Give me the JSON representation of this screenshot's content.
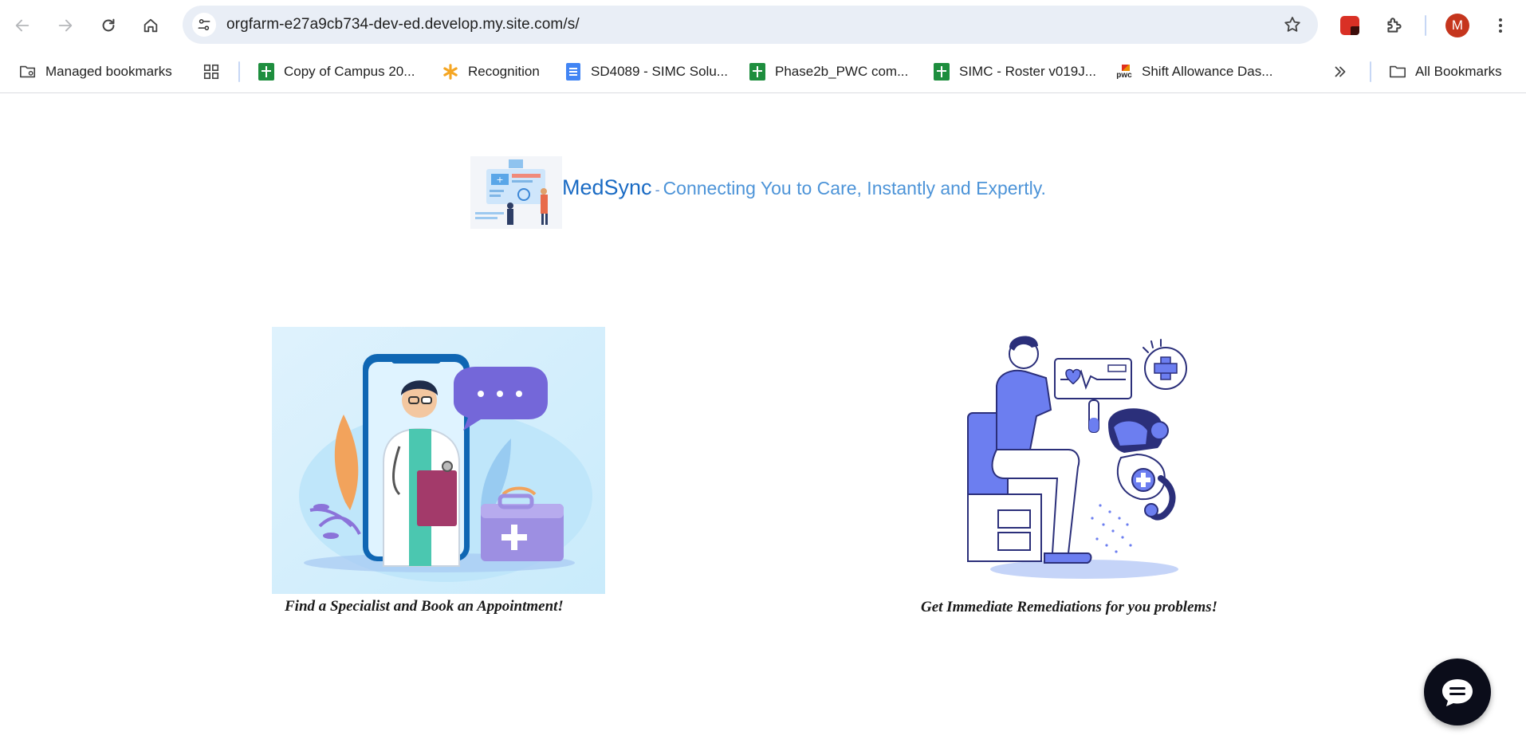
{
  "browser": {
    "url": "orgfarm-e27a9cb734-dev-ed.develop.my.site.com/s/",
    "profile_initial": "M",
    "bookmarks": [
      {
        "label": "Managed bookmarks",
        "icon": "managed-folder-icon"
      },
      {
        "label": "Copy of Campus 20...",
        "icon": "sheets-icon"
      },
      {
        "label": "Recognition",
        "icon": "asterisk-icon"
      },
      {
        "label": "SD4089 - SIMC Solu...",
        "icon": "docs-icon"
      },
      {
        "label": "Phase2b_PWC com...",
        "icon": "sheets-icon"
      },
      {
        "label": "SIMC - Roster v019J...",
        "icon": "sheets-icon"
      },
      {
        "label": "Shift Allowance Das...",
        "icon": "pwc-icon"
      },
      {
        "label": "All Bookmarks",
        "icon": "folder-icon"
      }
    ],
    "pwc_logo_text": "pwc"
  },
  "page": {
    "brand_name": "MedSync",
    "brand_separator": "-",
    "tagline": "Connecting You to Care, Instantly and Expertly.",
    "cards": [
      {
        "caption": "Find a Specialist and Book an Appointment!"
      },
      {
        "caption": "Get Immediate Remediations for you problems!"
      }
    ]
  },
  "colors": {
    "brand": "#1a6bc4",
    "tagline": "#4d94d8",
    "illustration_purple": "#6c7ef0",
    "chat_button": "#0b0d1a"
  }
}
